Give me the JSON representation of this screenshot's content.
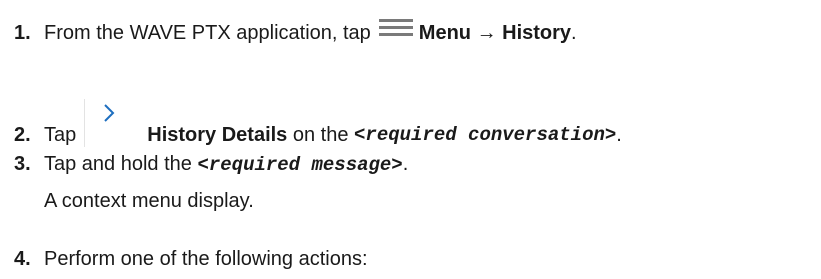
{
  "steps": [
    {
      "num": "1.",
      "pre": "From the WAVE PTX application, tap",
      "icon": "hamburger-menu-icon",
      "bold": "Menu → History",
      "post": "."
    },
    {
      "num": "2.",
      "pre": "Tap",
      "icon": "chevron-right-icon",
      "bold": "History Details",
      "mid": " on the ",
      "code": "<required conversation>",
      "post": "."
    },
    {
      "num": "3.",
      "pre": "Tap and hold the ",
      "code": "<required message>",
      "post": ".",
      "result": "A context menu display."
    },
    {
      "num": "4.",
      "pre": "Perform one of the following actions:"
    }
  ],
  "colors": {
    "text": "#1a1a1a",
    "icon": "#7a7a7a",
    "chevron": "#1e6fc0"
  }
}
